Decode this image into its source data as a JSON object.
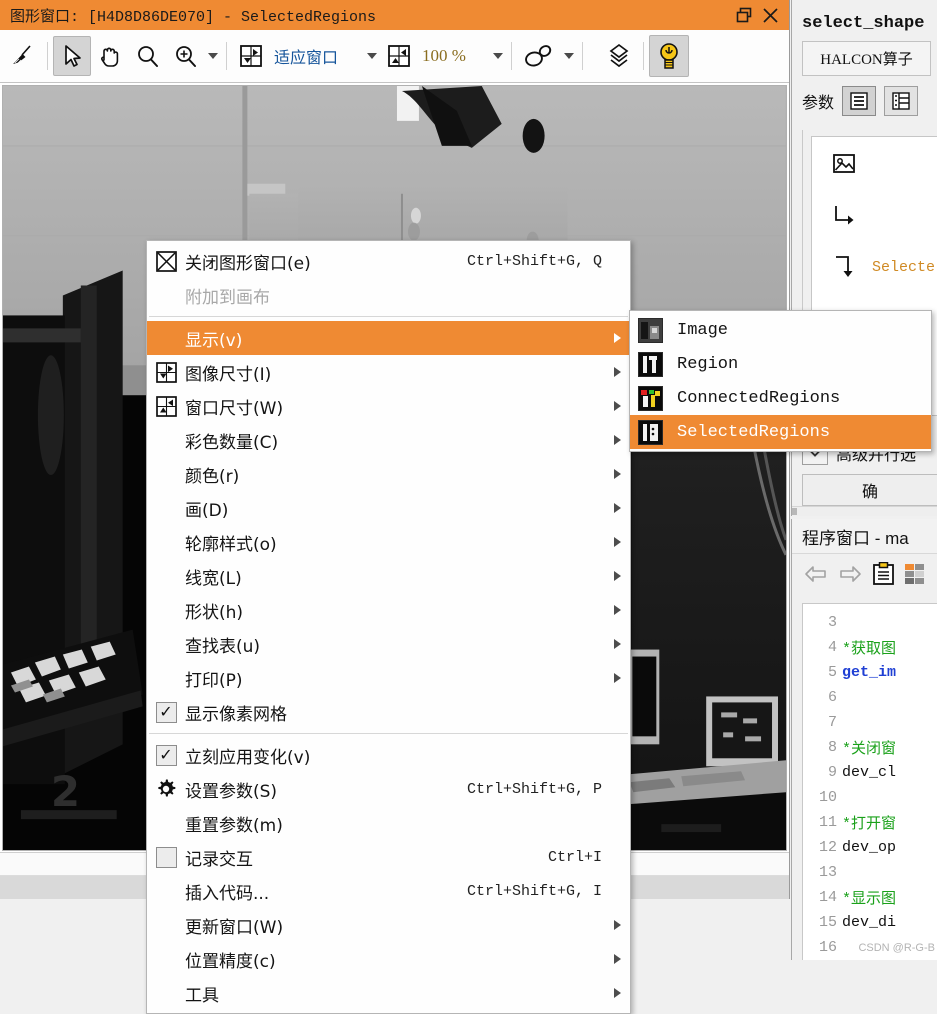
{
  "graphics_window": {
    "title": "图形窗口: [H4D8D86DE070] - SelectedRegions",
    "title_buttons": [
      {
        "name": "restore-button",
        "glyph": "restore-icon"
      },
      {
        "name": "close-button",
        "glyph": "close-icon"
      }
    ],
    "toolbar": {
      "items": [
        {
          "name": "clear-button",
          "icon": "broom-icon",
          "label": "",
          "active": false
        },
        {
          "name": "select-tool-button",
          "icon": "cursor-arrow-icon",
          "label": "",
          "active": true
        },
        {
          "name": "pan-tool-button",
          "icon": "hand-icon",
          "label": "",
          "active": false
        },
        {
          "name": "zoom-tool-button",
          "icon": "magnifier-icon",
          "label": "",
          "active": false
        },
        {
          "name": "zoom-in-button",
          "icon": "magnifier-plus-icon",
          "label": "",
          "active": false
        }
      ],
      "fit_window_label": "适应窗口",
      "zoom_value_label": "100 %",
      "shape_tool_name": "shape-icon",
      "layers_name": "layers-icon",
      "bulb_name": "lightbulb-icon"
    }
  },
  "context_menu": {
    "items": [
      {
        "label": "关闭图形窗口(e)",
        "accel": "Ctrl+Shift+G, Q",
        "icon": "close-window-icon",
        "mnemonic": "e",
        "state": "normal",
        "submenu": false,
        "name": "menu-close-graphics-window"
      },
      {
        "label": "附加到画布",
        "accel": "",
        "icon": "",
        "mnemonic": "",
        "state": "disabled",
        "submenu": false,
        "name": "menu-attach-to-canvas"
      },
      {
        "separator": true
      },
      {
        "label": "显示(v)",
        "accel": "",
        "icon": "",
        "mnemonic": "v",
        "state": "selected",
        "submenu": true,
        "name": "menu-display"
      },
      {
        "label": "图像尺寸(I)",
        "accel": "",
        "icon": "image-size-icon",
        "mnemonic": "I",
        "state": "normal",
        "submenu": true,
        "name": "menu-image-size"
      },
      {
        "label": "窗口尺寸(W)",
        "accel": "",
        "icon": "window-size-icon",
        "mnemonic": "W",
        "state": "normal",
        "submenu": true,
        "name": "menu-window-size"
      },
      {
        "label": "彩色数量(C)",
        "accel": "",
        "icon": "",
        "mnemonic": "C",
        "state": "normal",
        "submenu": true,
        "name": "menu-color-count"
      },
      {
        "label": "颜色(r)",
        "accel": "",
        "icon": "",
        "mnemonic": "r",
        "state": "normal",
        "submenu": true,
        "name": "menu-color"
      },
      {
        "label": "画(D)",
        "accel": "",
        "icon": "",
        "mnemonic": "D",
        "state": "normal",
        "submenu": true,
        "name": "menu-draw"
      },
      {
        "label": "轮廓样式(o)",
        "accel": "",
        "icon": "",
        "mnemonic": "o",
        "state": "normal",
        "submenu": true,
        "name": "menu-contour-style"
      },
      {
        "label": "线宽(L)",
        "accel": "",
        "icon": "",
        "mnemonic": "L",
        "state": "normal",
        "submenu": true,
        "name": "menu-line-width"
      },
      {
        "label": "形状(h)",
        "accel": "",
        "icon": "",
        "mnemonic": "h",
        "state": "normal",
        "submenu": true,
        "name": "menu-shape"
      },
      {
        "label": "查找表(u)",
        "accel": "",
        "icon": "",
        "mnemonic": "u",
        "state": "normal",
        "submenu": true,
        "name": "menu-lookup-table"
      },
      {
        "label": "打印(P)",
        "accel": "",
        "icon": "",
        "mnemonic": "P",
        "state": "normal",
        "submenu": true,
        "name": "menu-print"
      },
      {
        "label": "显示像素网格",
        "accel": "",
        "icon": "checkbox-checked",
        "mnemonic": "",
        "state": "normal",
        "submenu": false,
        "name": "menu-show-pixel-grid"
      },
      {
        "separator": true
      },
      {
        "label": "立刻应用变化(v)",
        "accel": "",
        "icon": "checkbox-checked",
        "mnemonic": "v",
        "state": "normal",
        "submenu": false,
        "name": "menu-apply-changes-immediately"
      },
      {
        "label": "设置参数(S)",
        "accel": "Ctrl+Shift+G, P",
        "icon": "gear-icon",
        "mnemonic": "S",
        "state": "normal",
        "submenu": false,
        "name": "menu-set-parameters"
      },
      {
        "label": "重置参数(m)",
        "accel": "",
        "icon": "",
        "mnemonic": "m",
        "state": "normal",
        "submenu": false,
        "name": "menu-reset-parameters"
      },
      {
        "label": "记录交互",
        "accel": "Ctrl+I",
        "icon": "checkbox-unchecked",
        "mnemonic": "",
        "state": "normal",
        "submenu": false,
        "name": "menu-record-interaction"
      },
      {
        "label": "插入代码...",
        "accel": "Ctrl+Shift+G, I",
        "icon": "",
        "mnemonic": "",
        "state": "normal",
        "submenu": false,
        "name": "menu-insert-code"
      },
      {
        "label": "更新窗口(W)",
        "accel": "",
        "icon": "",
        "mnemonic": "W",
        "state": "normal",
        "submenu": true,
        "name": "menu-update-window"
      },
      {
        "label": "位置精度(c)",
        "accel": "",
        "icon": "",
        "mnemonic": "c",
        "state": "normal",
        "submenu": true,
        "name": "menu-position-precision"
      },
      {
        "label": "工具",
        "accel": "",
        "icon": "",
        "mnemonic": "",
        "state": "normal",
        "submenu": true,
        "name": "menu-tools"
      }
    ]
  },
  "submenu": {
    "items": [
      {
        "label": "Image",
        "selected": false,
        "name": "submenu-item-image"
      },
      {
        "label": "Region",
        "selected": false,
        "name": "submenu-item-region"
      },
      {
        "label": "ConnectedRegions",
        "selected": false,
        "name": "submenu-item-connectedregions"
      },
      {
        "label": "SelectedRegions",
        "selected": true,
        "name": "submenu-item-selectedregions"
      }
    ]
  },
  "operator_dialog": {
    "operator_name": "select_shape",
    "tab_label": "HALCON算子",
    "params_label": "参数",
    "view_buttons": [
      {
        "name": "list-view-button",
        "selected": true
      },
      {
        "name": "table-view-button",
        "selected": false
      }
    ],
    "param_rows": [
      {
        "icon": "image-param-icon",
        "value": ""
      },
      {
        "icon": "input-arrow-icon",
        "value": ""
      },
      {
        "icon": "output-arrow-icon",
        "value": "Selecte"
      },
      {
        "icon": "text-param-icon",
        "value": ""
      }
    ],
    "advanced_label": "高级并行选",
    "ok_label": "确"
  },
  "program_window": {
    "title": "程序窗口 - ma",
    "toolbar": [
      {
        "name": "back-arrow-icon"
      },
      {
        "name": "forward-arrow-icon"
      },
      {
        "name": "clipboard-icon"
      },
      {
        "name": "color-grid-icon"
      }
    ],
    "code_lines": [
      {
        "num": "3",
        "text": "",
        "style": "pl"
      },
      {
        "num": "4",
        "text": "*获取图",
        "style": "cmt"
      },
      {
        "num": "5",
        "text": "get_im",
        "style": "kw"
      },
      {
        "num": "6",
        "text": "",
        "style": "pl"
      },
      {
        "num": "7",
        "text": "",
        "style": "pl"
      },
      {
        "num": "8",
        "text": "*关闭窗",
        "style": "cmt"
      },
      {
        "num": "9",
        "text": "dev_cl",
        "style": "pl"
      },
      {
        "num": "10",
        "text": "",
        "style": "pl"
      },
      {
        "num": "11",
        "text": "*打开窗",
        "style": "cmt"
      },
      {
        "num": "12",
        "text": "dev_op",
        "style": "pl"
      },
      {
        "num": "13",
        "text": "",
        "style": "pl"
      },
      {
        "num": "14",
        "text": "*显示图",
        "style": "cmt"
      },
      {
        "num": "15",
        "text": "dev_di",
        "style": "pl"
      },
      {
        "num": "16",
        "text": "",
        "style": "pl"
      }
    ],
    "watermark": "CSDN @R-G-B"
  },
  "colors": {
    "accent_orange": "#ef8a33",
    "title_bar": "#ef8a33",
    "menu_bg": "#fefefe",
    "panel_bg": "#f0f0f0",
    "code_comment": "#1aa11a",
    "code_keyword": "#1f3fd4",
    "param_value": "#d08a24"
  }
}
